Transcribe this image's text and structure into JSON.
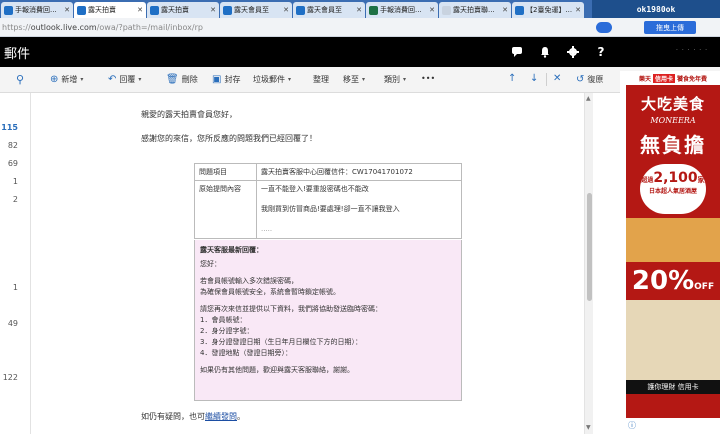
{
  "browser": {
    "tabs": [
      {
        "title": "手報消費回...",
        "favicon": "outlook"
      },
      {
        "title": "露天拍賣",
        "favicon": "outlook"
      },
      {
        "title": "露天拍賣",
        "favicon": "outlook"
      },
      {
        "title": "露天會員至",
        "favicon": "outlook"
      },
      {
        "title": "露天會員至",
        "favicon": "outlook"
      },
      {
        "title": "手報消費回...",
        "favicon": "excel"
      },
      {
        "title": "露天拍賣聯...",
        "favicon": "blank"
      },
      {
        "title": "【2臺免運】...",
        "favicon": "outlook"
      }
    ],
    "counter": "ok1980ok",
    "address": {
      "scheme": "https://",
      "host": "outlook.live.com",
      "path": "/owa/?path=/mail/inbox/rp"
    },
    "upload_label": "拖曳上傳"
  },
  "outlook": {
    "app_name": "郵件",
    "header_icons": [
      "chat-icon",
      "bell-icon",
      "gear-icon",
      "help-icon"
    ],
    "command_bar": {
      "new_label": "新增",
      "reply_label": "回覆",
      "delete_label": "刪除",
      "archive_label": "封存",
      "junk_label": "垃圾郵件",
      "sweep_label": "整理",
      "move_label": "移至",
      "categorize_label": "類別",
      "more_label": "•••",
      "undo_label": "復原"
    },
    "folder_counts": [
      "115",
      "82",
      "69",
      "1",
      "2",
      "1",
      "49",
      "122"
    ]
  },
  "message": {
    "greeting": "親愛的露天拍賣會員您好，",
    "thanks": "感謝您的來信，您所反應的問題我們已經回覆了！",
    "table": [
      {
        "label": "問題項目",
        "value": "露天拍賣客服中心回覆信件：CW17041701072"
      },
      {
        "label": "原始提問內容",
        "value_lines": [
          "一直不能登入!要重設密碼也不能改",
          "",
          "我剛買到仿冒商品!要處理!卻一直不讓我登入",
          "",
          "....."
        ]
      }
    ],
    "reply_title": "露天客服最新回覆：",
    "reply_lines": [
      "您好：",
      "",
      "若會員帳號輸入多次錯誤密碼，",
      "為確保會員帳號安全，系統會暫時鎖定帳號。",
      "",
      "請您再次來信並提供以下資料，我們將協助發送臨時密碼：",
      "1．會員帳號：",
      "2．身分證字號：",
      "3．身分證發證日期（生日年月日欄位下方的日期）：",
      "4．發證地點（發證日期旁）：",
      "",
      "如果仍有其他問題，歡迎與露天客服聯絡，謝謝。"
    ],
    "footer_prefix": "如仍有疑問，也可",
    "footer_link": "繼續發問",
    "footer_suffix": "。"
  },
  "ad": {
    "top_left": "樂天",
    "top_badge": "信用卡",
    "top_right": "饕食免年費",
    "title": "大吃美食",
    "subtitle": "MONEERA",
    "big": "無負擔",
    "badge_prefix": "超過",
    "badge_number": "2,100",
    "badge_unit": "家",
    "badge_text": "日本超人氣居酒屋",
    "percent": "20%",
    "percent_suffix": "OFF",
    "footer": "護你理財 信用卡"
  },
  "colors": {
    "tabstrip": "#3b6db2",
    "outlook_header": "#000000",
    "accent": "#2a6ebb",
    "reply_box": "#f9e8f6",
    "ad_red": "#b41814"
  }
}
